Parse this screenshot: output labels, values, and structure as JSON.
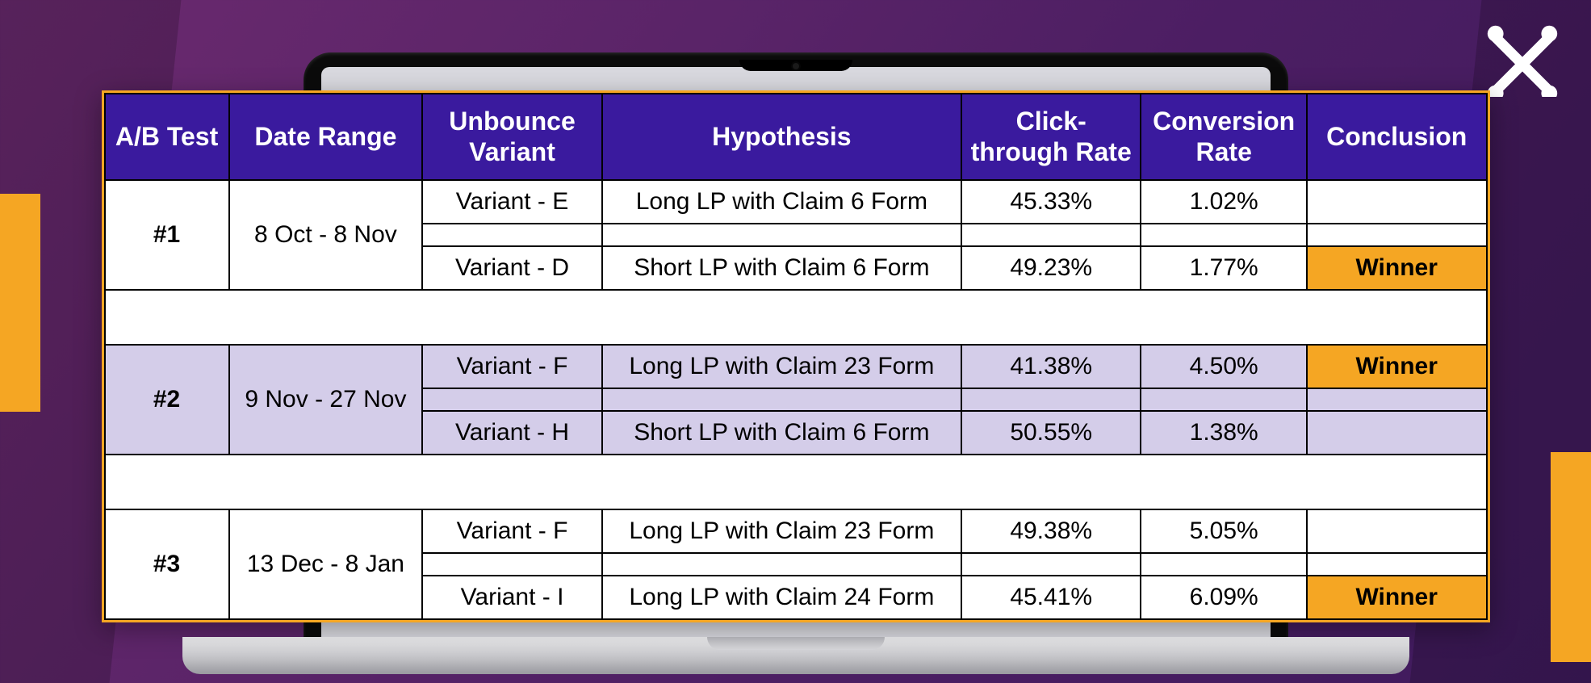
{
  "headers": {
    "test": "A/B Test",
    "date": "Date Range",
    "variant": "Unbounce Variant",
    "hypothesis": "Hypothesis",
    "ctr": "Click-through Rate",
    "cvr": "Conversion Rate",
    "conclusion": "Conclusion"
  },
  "winner_label": "Winner",
  "tests": [
    {
      "id": "#1",
      "date_range": "8 Oct - 8 Nov",
      "shaded": false,
      "rows": [
        {
          "variant": "Variant - E",
          "hypothesis": "Long LP with Claim 6 Form",
          "ctr": "45.33%",
          "cvr": "1.02%",
          "winner": false
        },
        {
          "variant": "Variant - D",
          "hypothesis": "Short LP with Claim 6 Form",
          "ctr": "49.23%",
          "cvr": "1.77%",
          "winner": true
        }
      ]
    },
    {
      "id": "#2",
      "date_range": "9 Nov - 27 Nov",
      "shaded": true,
      "rows": [
        {
          "variant": "Variant - F",
          "hypothesis": "Long LP with Claim 23 Form",
          "ctr": "41.38%",
          "cvr": "4.50%",
          "winner": true
        },
        {
          "variant": "Variant - H",
          "hypothesis": "Short LP with Claim 6 Form",
          "ctr": "50.55%",
          "cvr": "1.38%",
          "winner": false
        }
      ]
    },
    {
      "id": "#3",
      "date_range": "13 Dec - 8 Jan",
      "shaded": false,
      "rows": [
        {
          "variant": "Variant - F",
          "hypothesis": "Long LP with Claim 23 Form",
          "ctr": "49.38%",
          "cvr": "5.05%",
          "winner": false
        },
        {
          "variant": "Variant - I",
          "hypothesis": "Long LP with Claim 24 Form",
          "ctr": "45.41%",
          "cvr": "6.09%",
          "winner": true
        }
      ]
    }
  ]
}
